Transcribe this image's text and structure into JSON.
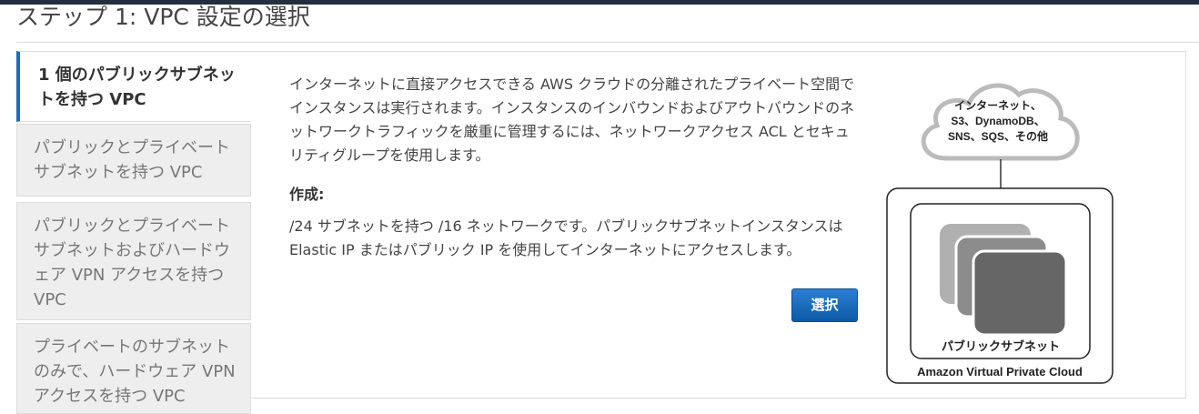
{
  "page": {
    "title": "ステップ 1: VPC 設定の選択"
  },
  "tabs": [
    {
      "label": "1 個のパブリックサブネットを持つ VPC",
      "active": true
    },
    {
      "label": "パブリックとプライベートサブネットを持つ VPC",
      "active": false
    },
    {
      "label": "パブリックとプライベートサブネットおよびハードウェア VPN アクセスを持つ VPC",
      "active": false
    },
    {
      "label": "プライベートのサブネットのみで、ハードウェア VPN アクセスを持つ VPC",
      "active": false
    }
  ],
  "main": {
    "description": "インターネットに直接アクセスできる AWS クラウドの分離されたプライベート空間でインスタンスは実行されます。インスタンスのインバウンドおよびアウトバウンドのネットワークトラフィックを厳重に管理するには、ネットワークアクセス ACL とセキュリティグループを使用します。",
    "create_heading": "作成:",
    "create_detail": "/24 サブネットを持つ /16 ネットワークです。パブリックサブネットインスタンスは Elastic IP またはパブリック IP を使用してインターネットにアクセスします。",
    "select_label": "選択"
  },
  "diagram": {
    "cloud_line1": "インターネット、",
    "cloud_line2": "S3、DynamoDB、",
    "cloud_line3": "SNS、SQS、その他",
    "subnet_label": "パブリックサブネット",
    "vpc_label": "Amazon Virtual Private Cloud"
  },
  "colors": {
    "accent": "#1a6dbd",
    "button": "#0d5aa7",
    "topbar": "#232f3e"
  }
}
